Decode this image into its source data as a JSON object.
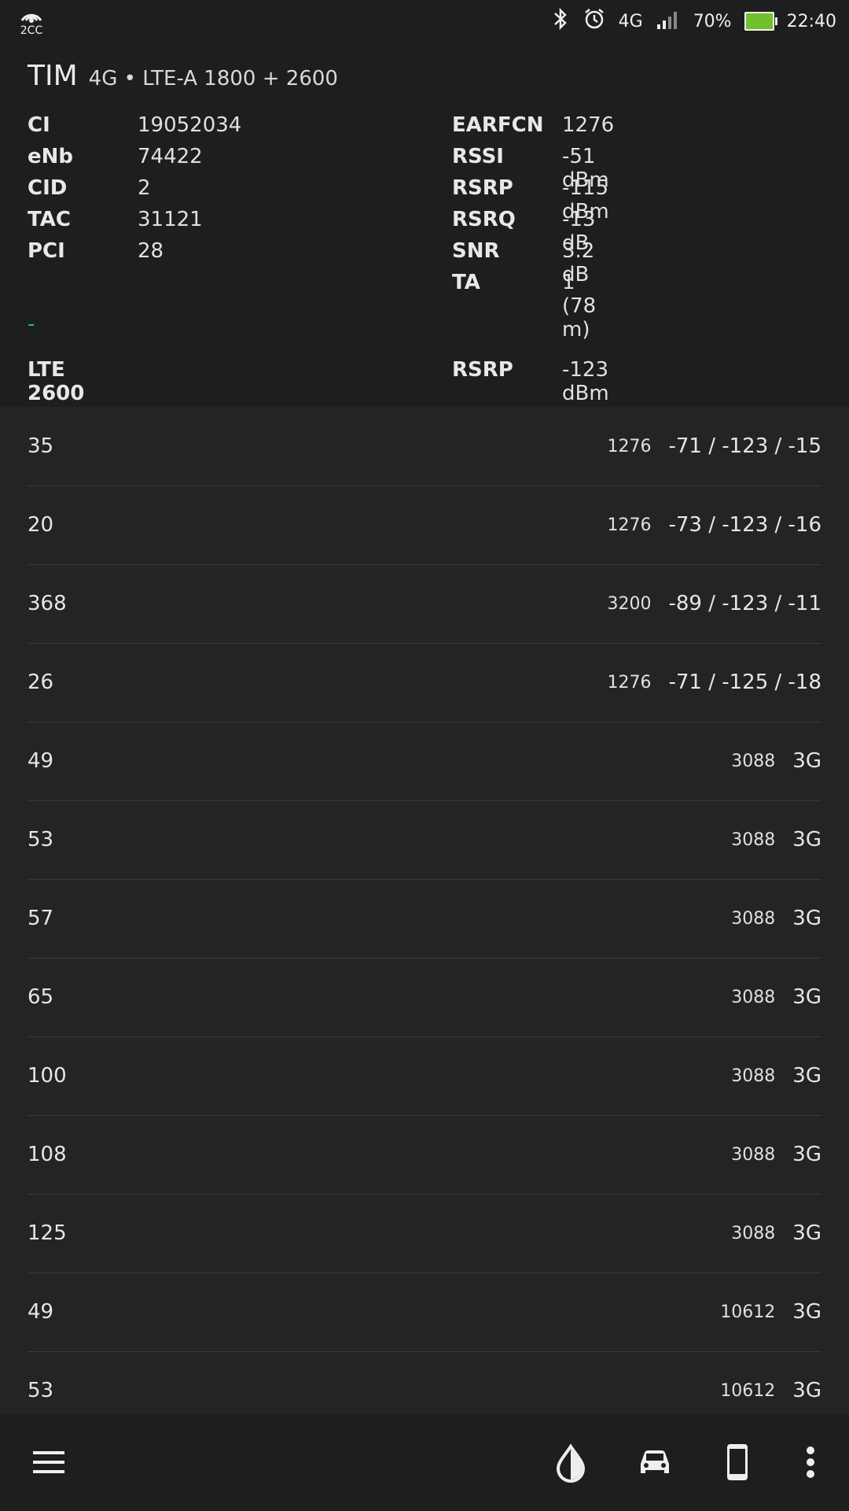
{
  "status_bar": {
    "left_label": "2CC",
    "network": "4G",
    "battery": "70%",
    "time": "22:40"
  },
  "header": {
    "carrier": "TIM",
    "tech": "4G • LTE-A 1800 + 2600",
    "left_fields": [
      {
        "k": "CI",
        "v": "19052034"
      },
      {
        "k": "eNb",
        "v": "74422"
      },
      {
        "k": "CID",
        "v": "2"
      },
      {
        "k": "TAC",
        "v": "31121"
      },
      {
        "k": "PCI",
        "v": "28"
      }
    ],
    "right_fields": [
      {
        "k": "EARFCN",
        "v": "1276"
      },
      {
        "k": "RSSI",
        "v": "-51 dBm"
      },
      {
        "k": "RSRP",
        "v": "-115 dBm"
      },
      {
        "k": "RSRQ",
        "v": "-13 dB"
      },
      {
        "k": "SNR",
        "v": "3.2 dB"
      },
      {
        "k": "TA",
        "v": "1 (78 m)"
      }
    ],
    "dash": "-",
    "secondary": {
      "band": "LTE 2600",
      "k": "RSRP",
      "v": "-123 dBm"
    }
  },
  "neighbors": [
    {
      "pci": "35",
      "freq": "1276",
      "val": "-71 / -123 / -15"
    },
    {
      "pci": "20",
      "freq": "1276",
      "val": "-73 / -123 / -16"
    },
    {
      "pci": "368",
      "freq": "3200",
      "val": "-89 / -123 / -11"
    },
    {
      "pci": "26",
      "freq": "1276",
      "val": "-71 / -125 / -18"
    },
    {
      "pci": "49",
      "freq": "3088",
      "val": "3G"
    },
    {
      "pci": "53",
      "freq": "3088",
      "val": "3G"
    },
    {
      "pci": "57",
      "freq": "3088",
      "val": "3G"
    },
    {
      "pci": "65",
      "freq": "3088",
      "val": "3G"
    },
    {
      "pci": "100",
      "freq": "3088",
      "val": "3G"
    },
    {
      "pci": "108",
      "freq": "3088",
      "val": "3G"
    },
    {
      "pci": "125",
      "freq": "3088",
      "val": "3G"
    },
    {
      "pci": "49",
      "freq": "10612",
      "val": "3G"
    },
    {
      "pci": "53",
      "freq": "10612",
      "val": "3G"
    }
  ]
}
